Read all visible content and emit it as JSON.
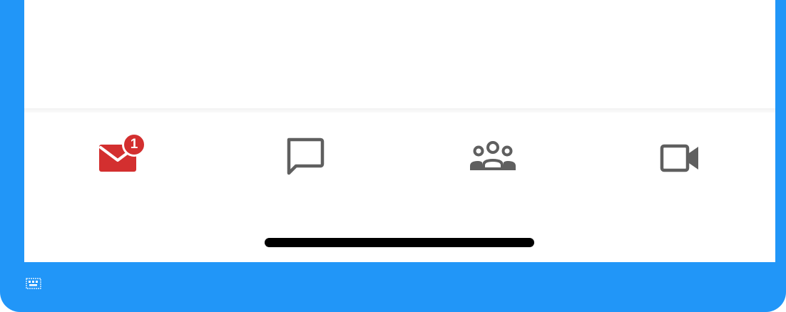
{
  "theme": {
    "frame_color": "#2196f8",
    "screen_color": "#ffffff",
    "active_color": "#d32f2f",
    "inactive_color": "#5f5f5f"
  },
  "tabbar": {
    "items": [
      {
        "id": "mail",
        "icon": "mail-icon",
        "active": true,
        "badge": "1"
      },
      {
        "id": "chat",
        "icon": "chat-bubble-icon",
        "active": false
      },
      {
        "id": "people",
        "icon": "group-icon",
        "active": false
      },
      {
        "id": "video",
        "icon": "video-camera-icon",
        "active": false
      }
    ]
  },
  "system": {
    "home_indicator": "home-indicator",
    "corner_icon": "keyboard-icon"
  }
}
